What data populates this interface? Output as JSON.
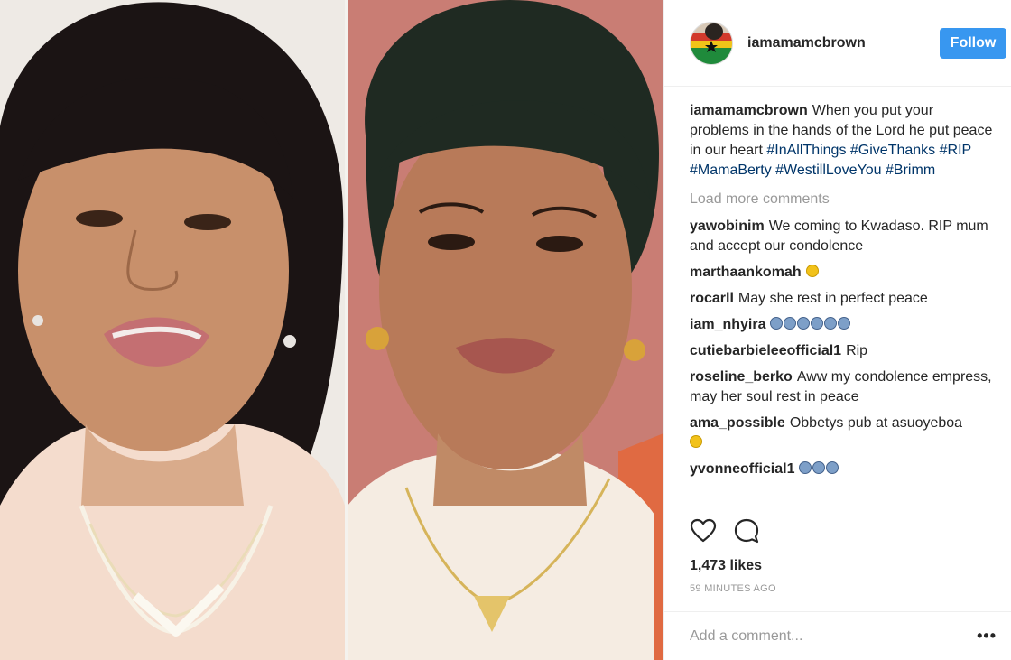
{
  "post": {
    "username": "iamamamcbrown",
    "follow_label": "Follow",
    "caption": {
      "username": "iamamamcbrown",
      "text": "When you put your problems in the hands of the Lord he put peace in our heart",
      "hashtags": [
        "#InAllThings",
        "#GiveThanks",
        "#RIP",
        "#MamaBerty",
        "#WestillLoveYou",
        "#Brimm"
      ]
    },
    "load_more_label": "Load more comments",
    "comments": [
      {
        "user": "yawobinim",
        "text": "We coming to Kwadaso. RIP mum and accept our condolence",
        "emoji": ""
      },
      {
        "user": "marthaankomah",
        "text": "",
        "emoji": "yellow"
      },
      {
        "user": "rocarll",
        "text": "May she rest in perfect peace",
        "emoji": ""
      },
      {
        "user": "iam_nhyira",
        "text": "",
        "emoji": "blue-row-6"
      },
      {
        "user": "cutiebarbieleeofficial1",
        "text": "Rip",
        "emoji": ""
      },
      {
        "user": "roseline_berko",
        "text": "Aww my condolence empress, may her soul rest in peace",
        "emoji": ""
      },
      {
        "user": "ama_possible",
        "text": "Obbetys pub at asuoyeboa",
        "emoji": "yellow"
      },
      {
        "user": "yvonneofficial1",
        "text": "",
        "emoji": "blue-row-3"
      }
    ],
    "likes": "1,473 likes",
    "timestamp": "59 MINUTES AGO",
    "add_comment_placeholder": "Add a comment...",
    "more_options": "•••",
    "icons": [
      "avatar",
      "heart-icon",
      "comment-icon",
      "more-options-icon"
    ],
    "colors": {
      "accent": "#3897f0",
      "hashtag": "#003569",
      "muted": "#999999",
      "text": "#262626"
    }
  }
}
